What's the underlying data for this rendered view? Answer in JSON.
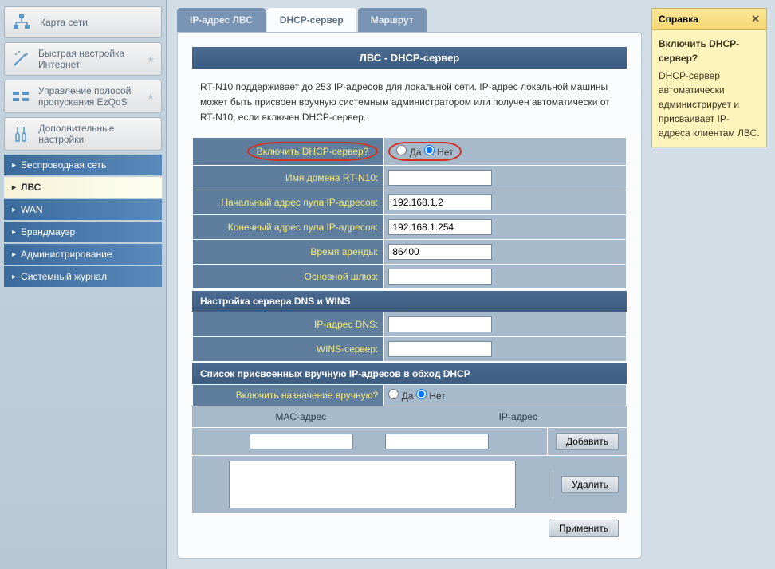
{
  "sidebar": {
    "main_items": [
      {
        "label": "Карта сети",
        "icon_color": "#5897c8"
      },
      {
        "label": "Быстрая настройка Интернет",
        "icon_color": "#5897c8"
      },
      {
        "label": "Управление полосой пропускания EzQoS",
        "icon_color": "#5897c8"
      },
      {
        "label": "Дополнительные настройки",
        "icon_color": "#5897c8"
      }
    ],
    "submenu": [
      {
        "label": "Беспроводная сеть"
      },
      {
        "label": "ЛВС"
      },
      {
        "label": "WAN"
      },
      {
        "label": "Брандмауэр"
      },
      {
        "label": "Администрирование"
      },
      {
        "label": "Системный журнал"
      }
    ]
  },
  "tabs": [
    {
      "label": "IP-адрес ЛВС"
    },
    {
      "label": "DHCP-сервер"
    },
    {
      "label": "Маршрут"
    }
  ],
  "panel": {
    "title": "ЛВС - DHCP-сервер",
    "description": "RT-N10 поддерживает до 253 IP-адресов для локальной сети. IP-адрес локальной машины может быть присвоен вручную системным администратором или получен автоматически от RT-N10, если включен DHCP-сервер."
  },
  "form": {
    "enable_dhcp_label": "Включить DHCP-сервер?",
    "yes": "Да",
    "no": "Нет",
    "domain_label": "Имя домена RT-N10:",
    "domain_value": "",
    "pool_start_label": "Начальный адрес пула IP-адресов:",
    "pool_start_value": "192.168.1.2",
    "pool_end_label": "Конечный адрес пула IP-адресов:",
    "pool_end_value": "192.168.1.254",
    "lease_label": "Время аренды:",
    "lease_value": "86400",
    "gateway_label": "Основной шлюз:",
    "gateway_value": ""
  },
  "dns_section": {
    "title": "Настройка сервера DNS и WINS",
    "dns_label": "IP-адрес DNS:",
    "dns_value": "",
    "wins_label": "WINS-сервер:",
    "wins_value": ""
  },
  "manual_section": {
    "title": "Список присвоенных вручную IP-адресов в обход DHCP",
    "enable_manual_label": "Включить назначение вручную?",
    "mac_header": "MAC-адрес",
    "ip_header": "IP-адрес"
  },
  "buttons": {
    "add": "Добавить",
    "delete": "Удалить",
    "apply": "Применить"
  },
  "help": {
    "title": "Справка",
    "heading": "Включить DHCP-сервер?",
    "text": "DHCP-сервер автоматически администрирует и присваивает IP-адреса клиентам ЛВС."
  }
}
